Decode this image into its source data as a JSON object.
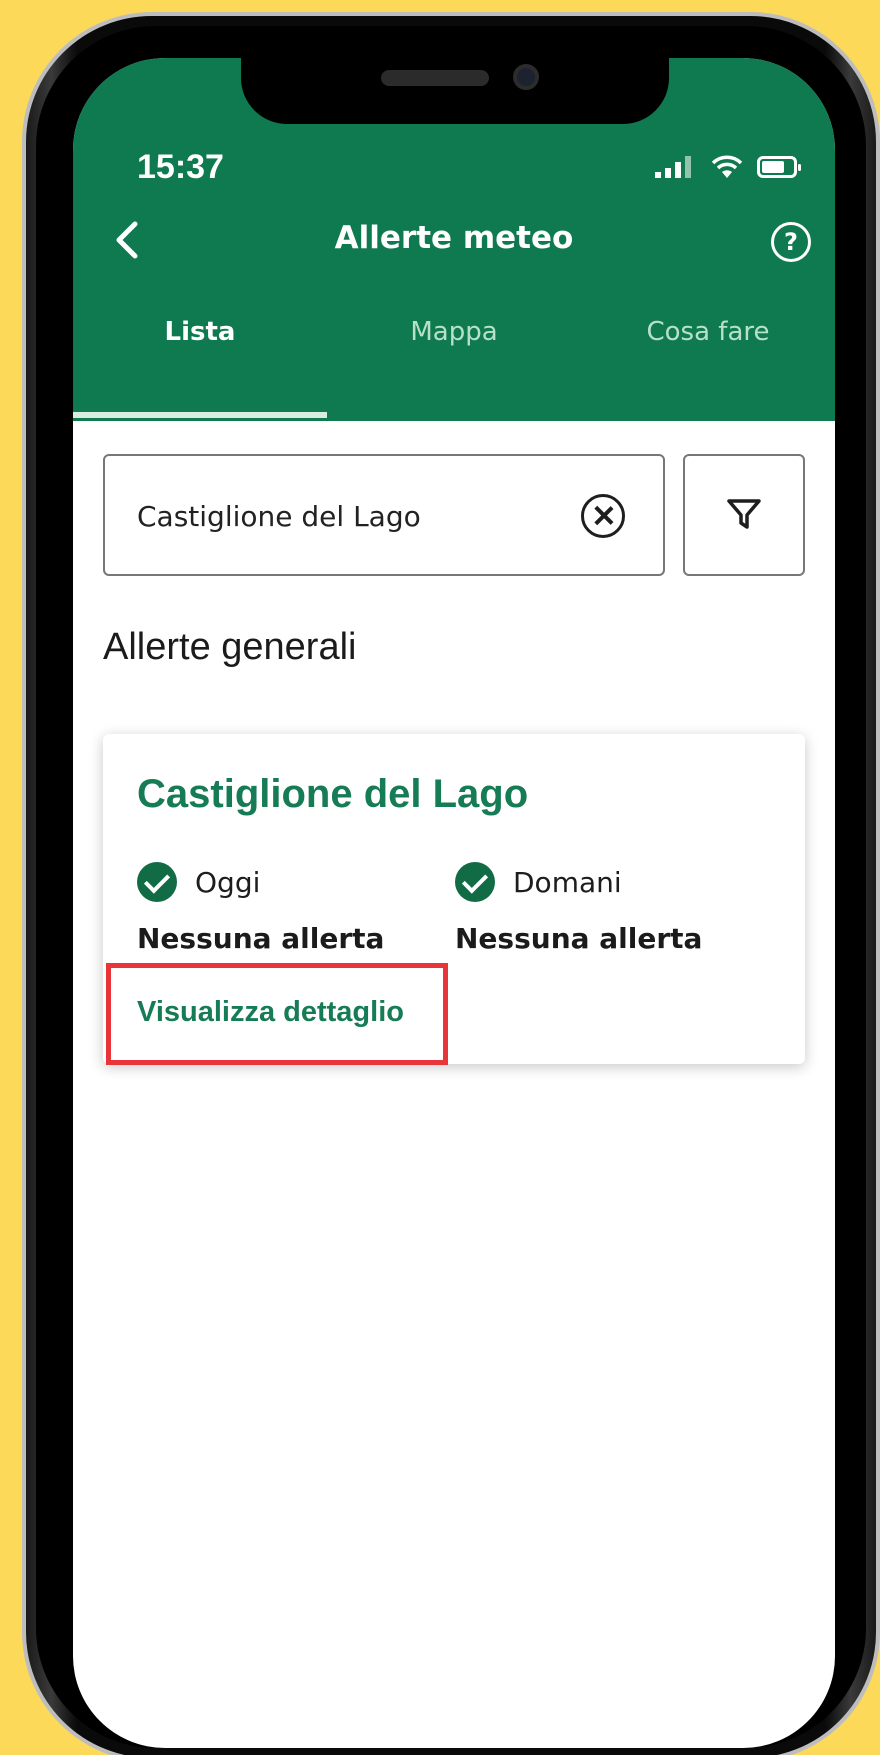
{
  "status_bar": {
    "time": "15:37"
  },
  "header": {
    "title": "Allerte meteo",
    "help_glyph": "?",
    "tabs": [
      {
        "label": "Lista",
        "active": true
      },
      {
        "label": "Mappa",
        "active": false
      },
      {
        "label": "Cosa fare",
        "active": false
      }
    ]
  },
  "search": {
    "value": "Castiglione del Lago"
  },
  "section": {
    "title": "Allerte generali"
  },
  "card": {
    "title": "Castiglione del Lago",
    "today": {
      "label": "Oggi",
      "status": "Nessuna allerta"
    },
    "tomorrow": {
      "label": "Domani",
      "status": "Nessuna allerta"
    },
    "link": "Visualizza dettaglio"
  },
  "colors": {
    "background": "#fdd95a",
    "header": "#0f7a4f",
    "accent": "#167c55",
    "highlight": "#e8353a"
  },
  "icons": [
    "back-icon",
    "help-icon",
    "clear-icon",
    "filter-icon",
    "check-icon"
  ]
}
